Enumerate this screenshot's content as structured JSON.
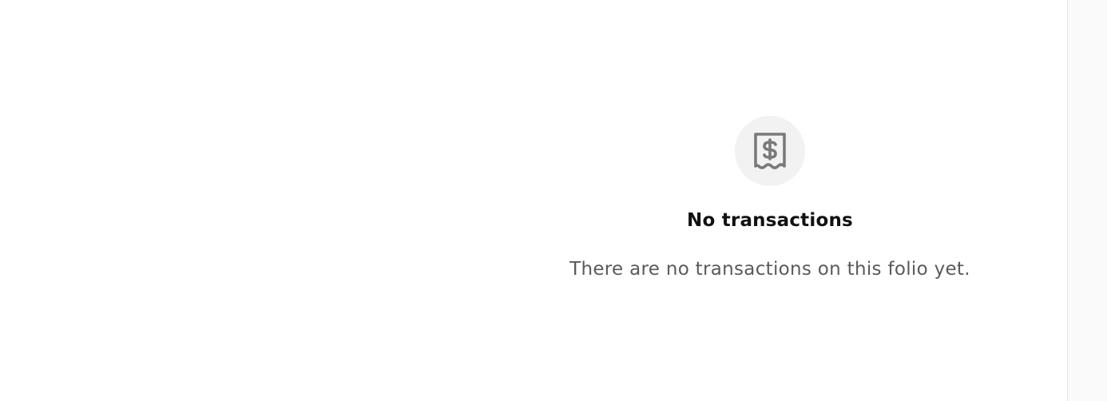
{
  "empty_state": {
    "icon": "receipt-dollar-icon",
    "title": "No transactions",
    "description": "There are no transactions on this folio yet."
  },
  "colors": {
    "icon_circle_bg": "#f2f2f2",
    "icon_stroke": "#7a7a7a",
    "title_text": "#111111",
    "description_text": "#5a5a5a",
    "side_panel_bg": "#fafafa",
    "divider": "#e6e6e6"
  }
}
